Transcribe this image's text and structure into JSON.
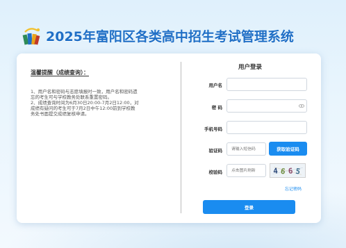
{
  "header": {
    "title": "2025年富阳区各类高中招生考试管理系统",
    "logo_icon": "books-logo-icon"
  },
  "notice": {
    "title": "温馨提醒（成绩查询）：",
    "lines": [
      "1、用户名和密码与志愿填报时一致，用户名和密码遗",
      "忘的考生可与学校教务处联系重置密码。",
      "2、成绩查询时间为6月30日20:00-7月2日12:00，对",
      "成绩有疑问的考生可于7月2日中午12:00前到学校教",
      "务处书面提交成绩复核申请。"
    ]
  },
  "login": {
    "title": "用户登录",
    "username_label": "用户名",
    "username_value": "",
    "password_label": "密  码",
    "password_value": "",
    "phone_label": "手机号码",
    "phone_value": "",
    "sms_label": "验证码",
    "sms_placeholder": "请输入短信码",
    "sms_button": "获取验证码",
    "captcha_label": "校验码",
    "captcha_placeholder": "点击图片刷新",
    "captcha_image_text": "4 6 6 5",
    "forgot_link": "忘记密码",
    "submit_button": "登录"
  },
  "colors": {
    "accent": "#1a8cf0",
    "title": "#1f6fc6",
    "background": "#e4f2fc"
  }
}
